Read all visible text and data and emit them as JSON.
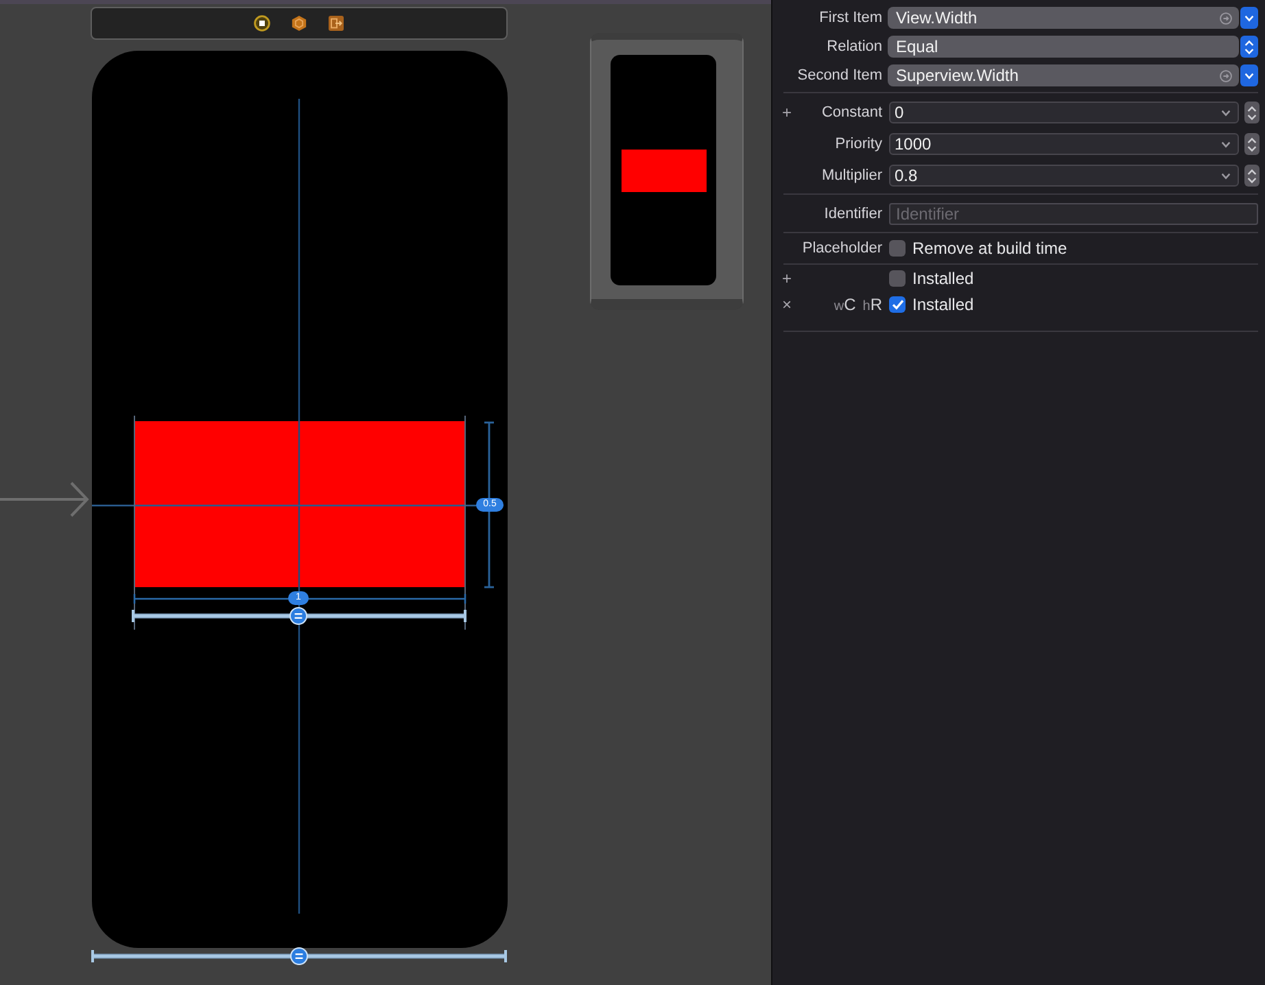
{
  "canvas": {
    "height_badge": "0.5",
    "width_badge": "1"
  },
  "inspector": {
    "item_rows": [
      {
        "kind": "item",
        "label": "First Item",
        "value": "View.Width"
      },
      {
        "kind": "relation",
        "label": "Relation",
        "value": "Equal"
      },
      {
        "kind": "item",
        "label": "Second Item",
        "value": "Superview.Width"
      }
    ],
    "number_rows": [
      {
        "action": "+",
        "label": "Constant",
        "value": "0"
      },
      {
        "label": "Priority",
        "value": "1000"
      },
      {
        "label": "Multiplier",
        "value": "0.8"
      }
    ],
    "identifier": {
      "label": "Identifier",
      "placeholder": "Identifier"
    },
    "placeholder": {
      "label": "Placeholder",
      "option": "Remove at build time",
      "checked": false
    },
    "installed_rows": [
      {
        "action": "+",
        "label": "Installed",
        "checked": false
      },
      {
        "action": "×",
        "size_class": [
          {
            "axis": "w",
            "value": "C"
          },
          {
            "axis": "h",
            "value": "R"
          }
        ],
        "label": "Installed",
        "checked": true
      }
    ]
  }
}
